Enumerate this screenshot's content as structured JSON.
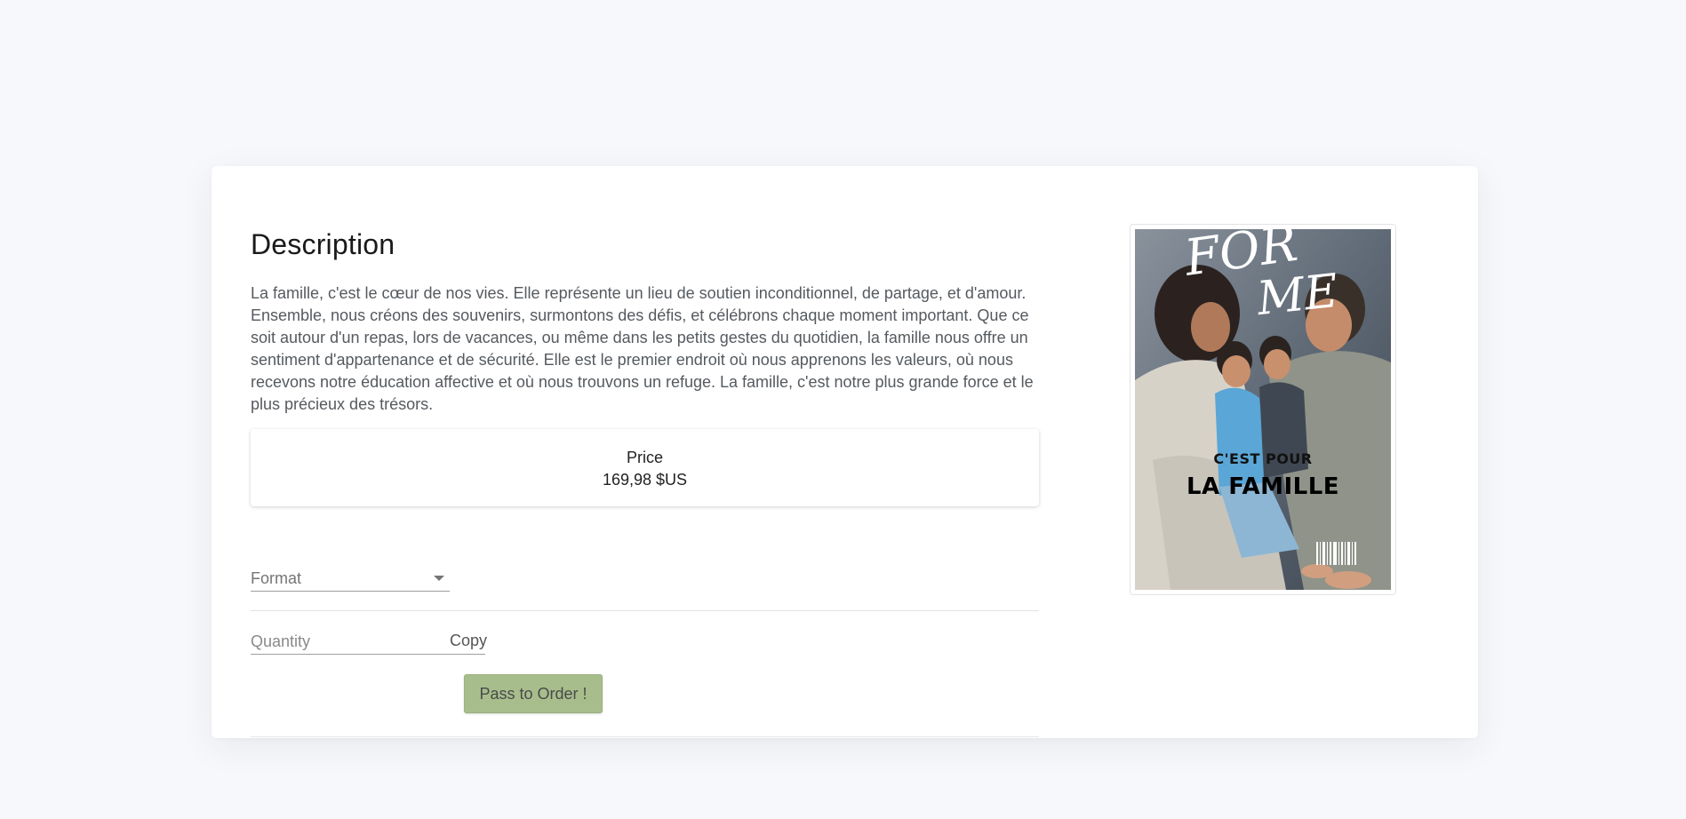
{
  "description": {
    "title": "Description",
    "text": "La famille, c'est le cœur de nos vies. Elle représente un lieu de soutien inconditionnel, de partage, et d'amour. Ensemble, nous créons des souvenirs, surmontons des défis, et célébrons chaque moment important. Que ce soit autour d'un repas, lors de vacances, ou même dans les petits gestes du quotidien, la famille nous offre un sentiment d'appartenance et de sécurité. Elle est le premier endroit où nous apprenons les valeurs, où nous recevons notre éducation affective et où nous trouvons un refuge. La famille, c'est notre plus grande force et le plus précieux des trésors."
  },
  "price": {
    "label": "Price",
    "value": "169,98 $US"
  },
  "form": {
    "format_label": "Format",
    "quantity_placeholder": "Quantity",
    "quantity_unit": "Copy",
    "order_button": "Pass to Order !"
  },
  "cover": {
    "script_title": "FOR ME",
    "line1": "C'EST POUR",
    "line2": "LA FAMILLE"
  },
  "colors": {
    "page_bg": "#f7f8fb",
    "button_bg": "#a7be8c"
  }
}
